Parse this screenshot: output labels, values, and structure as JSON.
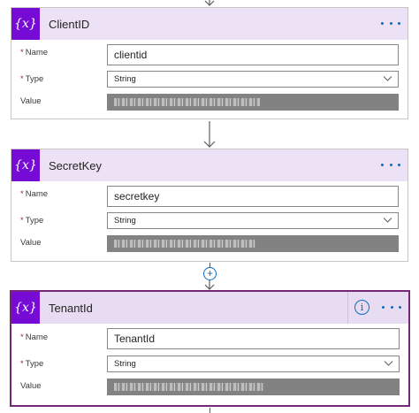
{
  "cards": [
    {
      "icon": "{x}",
      "title": "ClientID",
      "name_label": "Name",
      "name_value": "clientid",
      "type_label": "Type",
      "type_value": "String",
      "value_label": "Value"
    },
    {
      "icon": "{x}",
      "title": "SecretKey",
      "name_label": "Name",
      "name_value": "secretkey",
      "type_label": "Type",
      "type_value": "String",
      "value_label": "Value"
    },
    {
      "icon": "{x}",
      "title": "TenantId",
      "name_label": "Name",
      "name_value": "TenantId",
      "type_label": "Type",
      "type_value": "String",
      "value_label": "Value"
    }
  ],
  "required_marker": "*",
  "info_glyph": "i",
  "add_glyph": "+",
  "colors": {
    "accent_purple": "#770bd6",
    "header_bg": "#ede2f5",
    "selected_border": "#742774",
    "link_blue": "#0f6cbd",
    "redacted_gray": "#828282"
  },
  "icons": {
    "card_icon": "variable-icon",
    "menu": "more-options-icon",
    "info": "info-icon",
    "dropdown": "chevron-down-icon",
    "connector": "arrow-down-icon",
    "insert": "add-step-icon"
  }
}
